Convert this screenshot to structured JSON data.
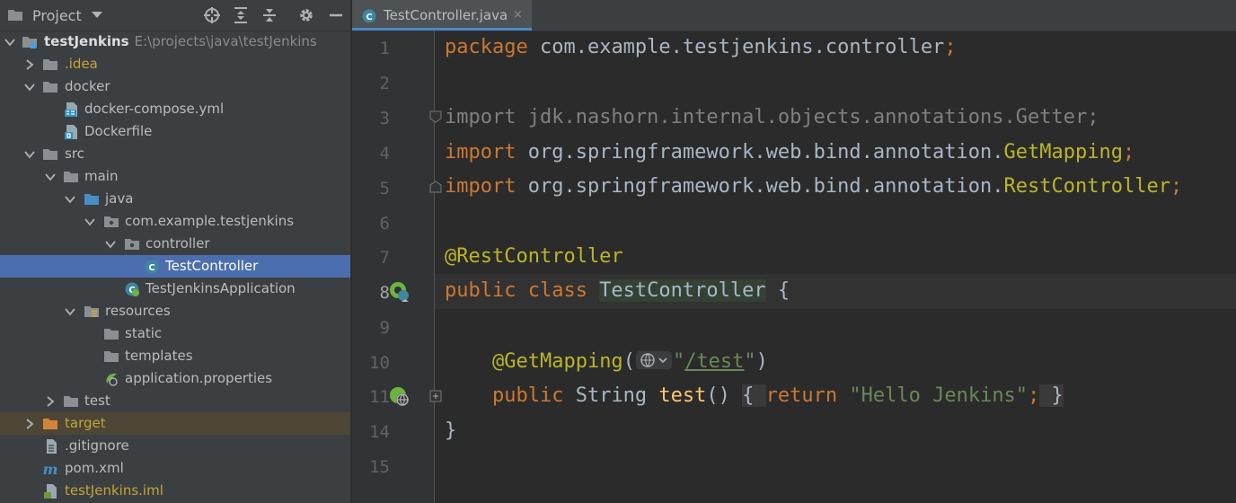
{
  "project_panel": {
    "title": "Project",
    "icons": [
      "locate-icon",
      "expand-all-icon",
      "collapse-all-icon",
      "gear-icon",
      "minimize-icon"
    ],
    "tree": [
      {
        "name": "testJenkins",
        "path": "E:\\projects\\java\\testJenkins"
      },
      {
        "name": ".idea"
      },
      {
        "name": "docker"
      },
      {
        "name": "docker-compose.yml"
      },
      {
        "name": "Dockerfile"
      },
      {
        "name": "src"
      },
      {
        "name": "main"
      },
      {
        "name": "java"
      },
      {
        "name": "com.example.testjenkins"
      },
      {
        "name": "controller"
      },
      {
        "name": "TestController"
      },
      {
        "name": "TestJenkinsApplication"
      },
      {
        "name": "resources"
      },
      {
        "name": "static"
      },
      {
        "name": "templates"
      },
      {
        "name": "application.properties"
      },
      {
        "name": "test"
      },
      {
        "name": "target"
      },
      {
        "name": ".gitignore"
      },
      {
        "name": "pom.xml"
      },
      {
        "name": "testJenkins.iml"
      }
    ]
  },
  "editor": {
    "tab": {
      "title": "TestController.java",
      "close": "×"
    },
    "lines": [
      {
        "num": "1",
        "segs": [
          {
            "t": "package ",
            "c": "kw"
          },
          {
            "t": "com.example.testjenkins.controller"
          },
          {
            "t": ";",
            "c": "kw"
          }
        ]
      },
      {
        "num": "2",
        "segs": []
      },
      {
        "num": "3",
        "segs": [
          {
            "t": "import ",
            "c": "grey"
          },
          {
            "t": "jdk.nashorn.internal.objects.annotations.Getter;",
            "c": "grey"
          }
        ]
      },
      {
        "num": "4",
        "segs": [
          {
            "t": "import ",
            "c": "kw"
          },
          {
            "t": "org.springframework.web.bind.annotation."
          },
          {
            "t": "GetMapping",
            "c": "ann"
          },
          {
            "t": ";",
            "c": "kw"
          }
        ]
      },
      {
        "num": "5",
        "segs": [
          {
            "t": "import ",
            "c": "kw"
          },
          {
            "t": "org.springframework.web.bind.annotation."
          },
          {
            "t": "RestController",
            "c": "ann"
          },
          {
            "t": ";",
            "c": "kw"
          }
        ]
      },
      {
        "num": "6",
        "segs": []
      },
      {
        "num": "7",
        "segs": [
          {
            "t": "@RestController",
            "c": "ann"
          }
        ]
      },
      {
        "num": "8",
        "segs": [
          {
            "t": "public class ",
            "c": "kw"
          },
          {
            "t": "TestController",
            "c": "hl"
          },
          {
            "t": " {"
          }
        ]
      },
      {
        "num": "9",
        "segs": []
      },
      {
        "num": "10",
        "segs": [
          {
            "t": "    "
          },
          {
            "t": "@GetMapping",
            "c": "ann"
          },
          {
            "t": "("
          },
          {
            "t": "",
            "c": "inlay"
          },
          {
            "t": "\"",
            "c": "str"
          },
          {
            "t": "/test",
            "c": "str url"
          },
          {
            "t": "\"",
            "c": "str"
          },
          {
            "t": ")"
          }
        ]
      },
      {
        "num": "11",
        "segs": [
          {
            "t": "    "
          },
          {
            "t": "public ",
            "c": "kw"
          },
          {
            "t": "String "
          },
          {
            "t": "test",
            "c": "fn"
          },
          {
            "t": "() "
          },
          {
            "t": "{ ",
            "c": "fbox"
          },
          {
            "t": "return ",
            "c": "kw"
          },
          {
            "t": "\"Hello Jenkins\"",
            "c": "str"
          },
          {
            "t": ";",
            "c": "kw"
          },
          {
            "t": " }",
            "c": "fbox"
          }
        ]
      },
      {
        "num": "14",
        "segs": [
          {
            "t": "}"
          }
        ]
      },
      {
        "num": "15",
        "segs": []
      }
    ]
  }
}
